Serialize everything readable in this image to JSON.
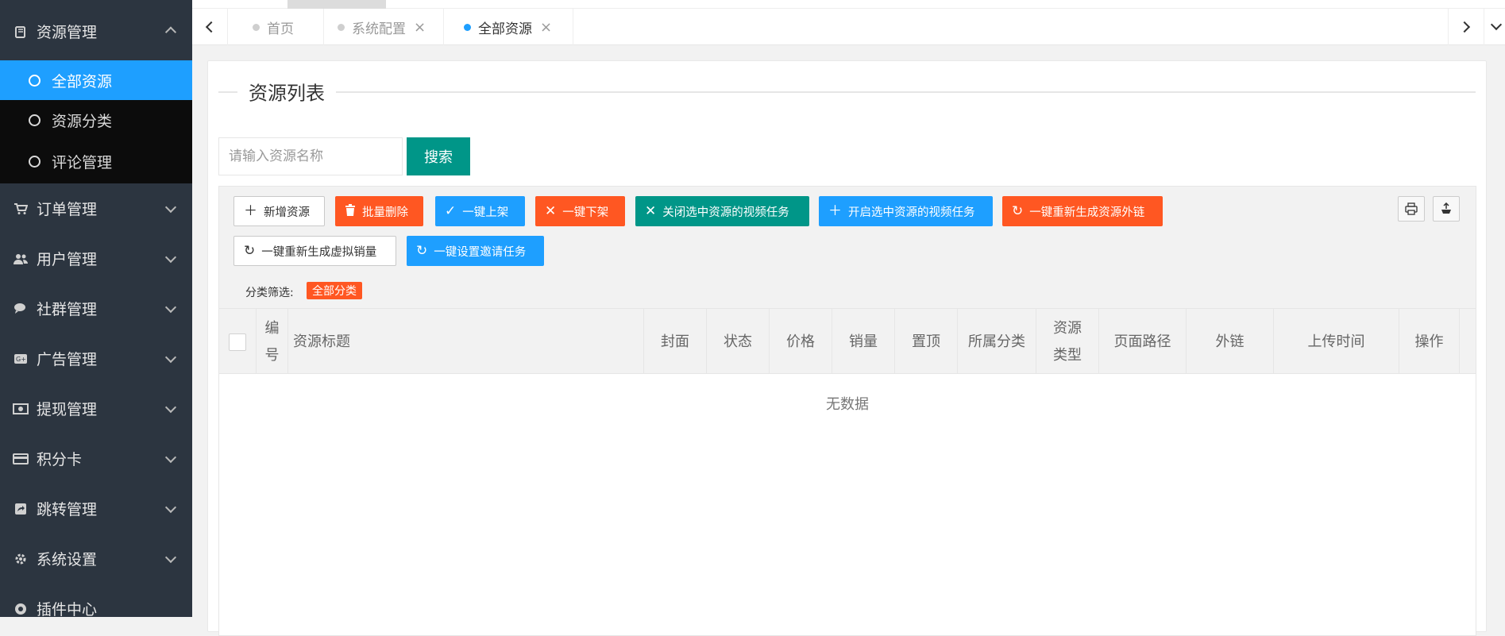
{
  "sidebar": {
    "groups": [
      {
        "label": "资源管理",
        "icon": "book-icon",
        "expanded": true,
        "children": [
          {
            "label": "全部资源",
            "active": true
          },
          {
            "label": "资源分类",
            "active": false
          },
          {
            "label": "评论管理",
            "active": false
          }
        ]
      },
      {
        "label": "订单管理",
        "icon": "cart-icon"
      },
      {
        "label": "用户管理",
        "icon": "users-icon"
      },
      {
        "label": "社群管理",
        "icon": "chat-icon"
      },
      {
        "label": "广告管理",
        "icon": "ad-icon"
      },
      {
        "label": "提现管理",
        "icon": "money-icon"
      },
      {
        "label": "积分卡",
        "icon": "card-icon"
      },
      {
        "label": "跳转管理",
        "icon": "redirect-icon"
      },
      {
        "label": "系统设置",
        "icon": "gear-icon"
      },
      {
        "label": "插件中心",
        "icon": "plugin-icon"
      }
    ]
  },
  "tabs": [
    {
      "label": "首页",
      "closable": false,
      "active": false
    },
    {
      "label": "系统配置",
      "closable": true,
      "active": false
    },
    {
      "label": "全部资源",
      "closable": true,
      "active": true
    }
  ],
  "main": {
    "title": "资源列表",
    "search": {
      "placeholder": "请输入资源名称",
      "button": "搜索"
    },
    "toolbar": {
      "buttons": [
        {
          "label": "新增资源",
          "icon": "plus-icon",
          "color": "#ffffff"
        },
        {
          "label": "批量删除",
          "icon": "trash-icon",
          "color": "#ff5722"
        },
        {
          "label": "一键上架",
          "icon": "check-icon",
          "color": "#1e9fff"
        },
        {
          "label": "一键下架",
          "icon": "close-icon",
          "color": "#ff5722"
        },
        {
          "label": "关闭选中资源的视频任务",
          "icon": "close-icon",
          "color": "#009688"
        },
        {
          "label": "开启选中资源的视频任务",
          "icon": "plus-icon",
          "color": "#1e9fff"
        },
        {
          "label": "一键重新生成资源外链",
          "icon": "refresh-icon",
          "color": "#ff5722"
        },
        {
          "label": "一键重新生成虚拟销量",
          "icon": "refresh-icon",
          "color": "#ffffff"
        },
        {
          "label": "一键设置邀请任务",
          "icon": "refresh-icon",
          "color": "#1e9fff"
        }
      ],
      "tools": [
        {
          "name": "print-icon"
        },
        {
          "name": "export-icon"
        }
      ]
    },
    "filter": {
      "label": "分类筛选:",
      "tag": "全部分类"
    },
    "table": {
      "columns": [
        "编号",
        "资源标题",
        "封面",
        "状态",
        "价格",
        "销量",
        "置顶",
        "所属分类",
        "资源类型",
        "页面路径",
        "外链",
        "上传时间",
        "操作"
      ],
      "empty_text": "无数据"
    }
  },
  "colors": {
    "sidebar_bg": "#2c3540",
    "active": "#1e9fff",
    "danger": "#ff5722",
    "primary": "#009688"
  }
}
